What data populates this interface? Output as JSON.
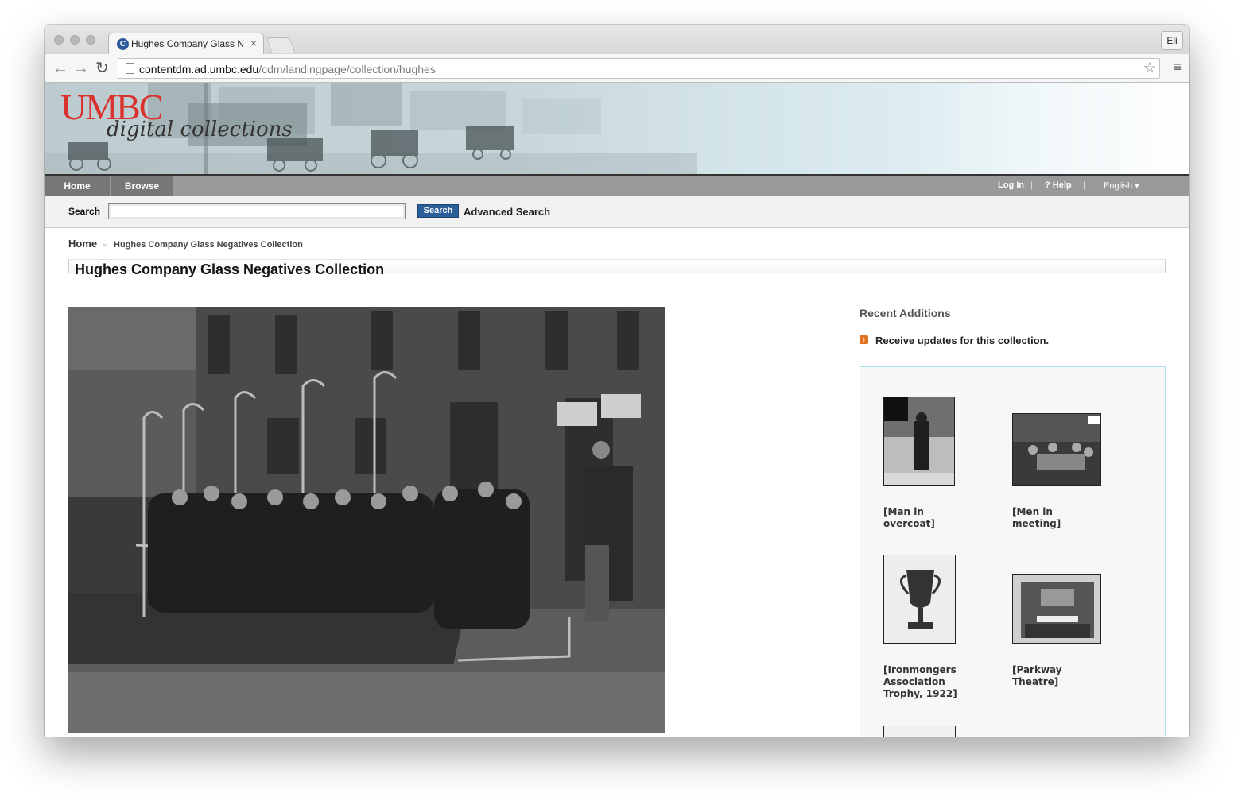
{
  "browser": {
    "tab_title": "Hughes Company Glass Ne",
    "url_host": "contentdm.ad.umbc.edu",
    "url_path": "/cdm/landingpage/collection/hughes",
    "profile": "Eli"
  },
  "banner": {
    "logo": "UMBC",
    "subtitle": "digital collections"
  },
  "nav": {
    "home": "Home",
    "browse": "Browse",
    "login": "Log In",
    "help": "? Help",
    "language": "English ▾",
    "sep": "|"
  },
  "search": {
    "label": "Search",
    "value": "",
    "button": "Search",
    "advanced": "Advanced Search"
  },
  "breadcrumb": {
    "home": "Home",
    "sep": "››",
    "current": "Hughes Company Glass Negatives Collection"
  },
  "page_title": "Hughes Company Glass Negatives Collection",
  "sidebar": {
    "heading": "Recent Additions",
    "rss": "Receive updates for this collection.",
    "items": [
      {
        "label_1": "[Man in",
        "label_2": "overcoat]"
      },
      {
        "label_1": "[Men in",
        "label_2": "meeting]"
      },
      {
        "label_1": "[Ironmongers",
        "label_2": "Association",
        "label_3": "Trophy, 1922]"
      },
      {
        "label_1": "[Parkway",
        "label_2": "Theatre]"
      }
    ]
  },
  "colors": {
    "umbc_red": "#d9322c",
    "nav_gray": "#999999",
    "search_blue": "#2b5f9a",
    "rss_orange": "#e2711d",
    "recent_border": "#a9dde8"
  }
}
